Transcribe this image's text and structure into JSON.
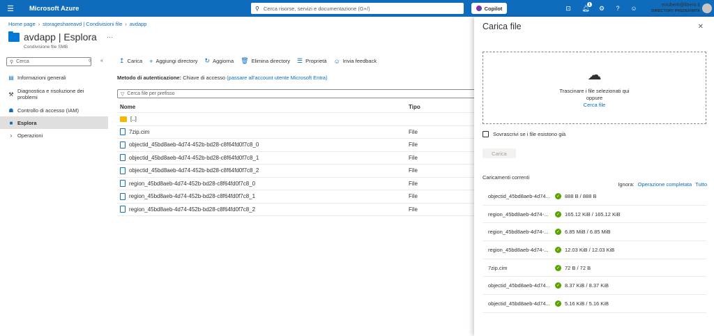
{
  "header": {
    "brand": "Microsoft Azure",
    "search_placeholder": "Cerca risorse, servizi e documentazione (G+/)",
    "copilot": "Copilot",
    "notifications_count": "1",
    "user_email": "mruberti@libero.it",
    "user_directory": "DIRECTORY PREDEFINITA",
    "icons": [
      "menu-icon",
      "search-icon",
      "cloud-shell-icon",
      "bell-icon",
      "gear-icon",
      "help-icon",
      "feedback-icon"
    ]
  },
  "breadcrumb": [
    "Home page",
    "storageshareavd | Condivisioni file",
    "avdapp"
  ],
  "page": {
    "title": "avdapp | Esplora",
    "subtitle": "Condivisione file SMB"
  },
  "sidebar": {
    "search_placeholder": "Cerca",
    "items": [
      {
        "label": "Informazioni generali",
        "icon": "overview-icon"
      },
      {
        "label": "Diagnostica e risoluzione dei problemi",
        "icon": "wrench-icon"
      },
      {
        "label": "Controllo di accesso (IAM)",
        "icon": "people-icon"
      },
      {
        "label": "Esplora",
        "icon": "folder-icon"
      },
      {
        "label": "Operazioni",
        "icon": "chevron-right-icon"
      }
    ]
  },
  "toolbar": {
    "upload": "Carica",
    "add_directory": "Aggiungi directory",
    "refresh": "Aggiorna",
    "delete_directory": "Elimina directory",
    "properties": "Proprietà",
    "feedback": "Invia feedback"
  },
  "auth": {
    "label": "Metodo di autenticazione:",
    "value": "Chiave di accesso",
    "link": "(passare all'account utente Microsoft Entra)"
  },
  "file_search_placeholder": "Cerca file per prefisso",
  "table": {
    "headers": [
      "Nome",
      "Tipo"
    ],
    "rows": [
      {
        "name": "[..]",
        "type": ""
      },
      {
        "name": "7zip.cim",
        "type": "File"
      },
      {
        "name": "objectid_45bd8aeb-4d74-452b-bd28-c8f64fd0f7c8_0",
        "type": "File"
      },
      {
        "name": "objectid_45bd8aeb-4d74-452b-bd28-c8f64fd0f7c8_1",
        "type": "File"
      },
      {
        "name": "objectid_45bd8aeb-4d74-452b-bd28-c8f64fd0f7c8_2",
        "type": "File"
      },
      {
        "name": "region_45bd8aeb-4d74-452b-bd28-c8f64fd0f7c8_0",
        "type": "File"
      },
      {
        "name": "region_45bd8aeb-4d74-452b-bd28-c8f64fd0f7c8_1",
        "type": "File"
      },
      {
        "name": "region_45bd8aeb-4d74-452b-bd28-c8f64fd0f7c8_2",
        "type": "File"
      }
    ]
  },
  "panel": {
    "title": "Carica file",
    "drop_line1": "Trascinare i file selezionati qui",
    "drop_line2": "oppure",
    "browse_link": "Cerca file",
    "overwrite_label": "Sovrascrivi se i file esistono già",
    "upload_button": "Carica",
    "current_uploads": "Caricamenti correnti",
    "ignore_label": "Ignora:",
    "ignore_completed": "Operazione completata",
    "ignore_all": "Tutto",
    "uploads": [
      {
        "name": "objectid_45bd8aeb-4d74...",
        "progress": "888 B / 888 B"
      },
      {
        "name": "region_45bd8aeb-4d74-...",
        "progress": "165.12 KiB / 165.12 KiB"
      },
      {
        "name": "region_45bd8aeb-4d74-...",
        "progress": "6.85 MiB / 6.85 MiB"
      },
      {
        "name": "region_45bd8aeb-4d74-...",
        "progress": "12.03 KiB / 12.03 KiB"
      },
      {
        "name": "7zip.cim",
        "progress": "72 B / 72 B"
      },
      {
        "name": "objectid_45bd8aeb-4d74...",
        "progress": "8.37 KiB / 8.37 KiB"
      },
      {
        "name": "objectid_45bd8aeb-4d74...",
        "progress": "5.16 KiB / 5.16 KiB"
      }
    ]
  },
  "colors": {
    "brand_blue": "#0f6cbd",
    "success_green": "#57a300"
  }
}
